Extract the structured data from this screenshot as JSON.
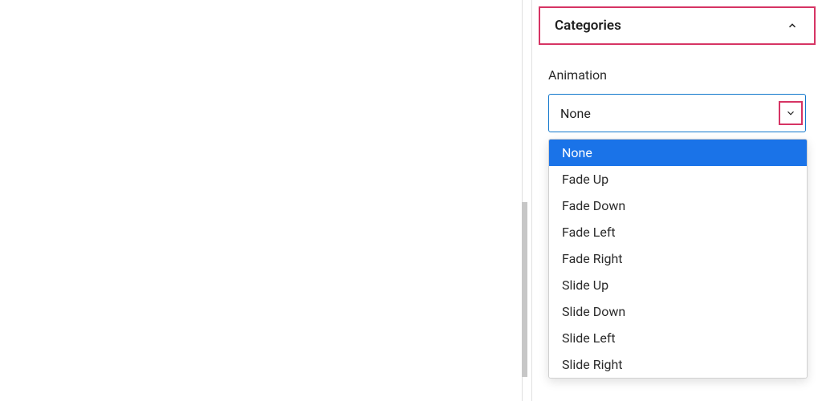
{
  "sidebar": {
    "section_title": "Categories",
    "animation": {
      "label": "Animation",
      "selected": "None",
      "options": [
        "None",
        "Fade Up",
        "Fade Down",
        "Fade Left",
        "Fade Right",
        "Slide Up",
        "Slide Down",
        "Slide Left",
        "Slide Right"
      ]
    }
  }
}
